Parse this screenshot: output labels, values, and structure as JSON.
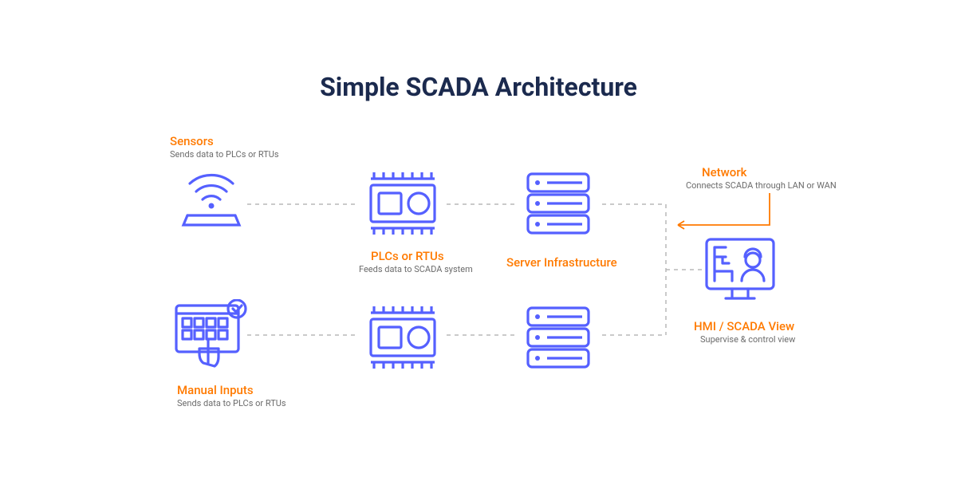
{
  "title": "Simple SCADA Architecture",
  "nodes": {
    "sensors": {
      "label": "Sensors",
      "sub": "Sends data to PLCs or RTUs"
    },
    "manual_inputs": {
      "label": "Manual Inputs",
      "sub": "Sends data to PLCs or RTUs"
    },
    "plcs": {
      "label": "PLCs or RTUs",
      "sub": "Feeds data to SCADA system"
    },
    "server": {
      "label": "Server Infrastructure",
      "sub": ""
    },
    "network": {
      "label": "Network",
      "sub": "Connects SCADA through LAN or WAN"
    },
    "hmi": {
      "label": "HMI / SCADA View",
      "sub": "Supervise & control view"
    }
  },
  "colors": {
    "accent": "#5560ff",
    "orange": "#ff7a00",
    "title": "#1b2a4e"
  },
  "connections": [
    [
      "sensors",
      "plcs_top"
    ],
    [
      "manual_inputs",
      "plcs_bottom"
    ],
    [
      "plcs_top",
      "server_top"
    ],
    [
      "plcs_bottom",
      "server_bottom"
    ],
    [
      "server_top",
      "hmi"
    ],
    [
      "server_bottom",
      "hmi"
    ]
  ]
}
